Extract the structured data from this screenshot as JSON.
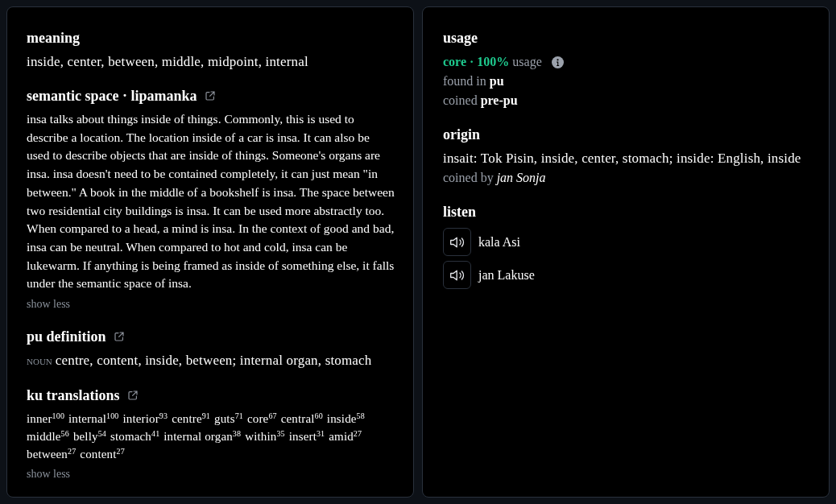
{
  "meaning": {
    "heading": "meaning",
    "text": "inside, center, between, middle, midpoint, internal"
  },
  "semantic_space": {
    "heading": "semantic space · lipamanka",
    "text": "insa talks about things inside of things. Commonly, this is used to describe a location. The location inside of a car is insa. It can also be used to describe objects that are inside of things. Someone's organs are insa. insa doesn't need to be contained completely, it can just mean \"in between.\" A book in the middle of a bookshelf is insa. The space between two residential city buildings is insa. It can be used more abstractly too. When compared to a head, a mind is insa. In the context of good and bad, insa can be neutral. When compared to hot and cold, insa can be lukewarm. If anything is being framed as inside of something else, it falls under the semantic space of insa.",
    "toggle": "show less"
  },
  "pu_definition": {
    "heading": "pu definition",
    "part_of_speech": "NOUN",
    "text": "centre, content, inside, between; internal organ, stomach"
  },
  "ku_translations": {
    "heading": "ku translations",
    "items": [
      {
        "word": "inner",
        "score": "100"
      },
      {
        "word": "internal",
        "score": "100"
      },
      {
        "word": "interior",
        "score": "93"
      },
      {
        "word": "centre",
        "score": "91"
      },
      {
        "word": "guts",
        "score": "71"
      },
      {
        "word": "core",
        "score": "67"
      },
      {
        "word": "central",
        "score": "60"
      },
      {
        "word": "inside",
        "score": "58"
      },
      {
        "word": "middle",
        "score": "56"
      },
      {
        "word": "belly",
        "score": "54"
      },
      {
        "word": "stomach",
        "score": "41"
      },
      {
        "word": "internal organ",
        "score": "38"
      },
      {
        "word": "within",
        "score": "35"
      },
      {
        "word": "insert",
        "score": "31"
      },
      {
        "word": "amid",
        "score": "27"
      },
      {
        "word": "between",
        "score": "27"
      },
      {
        "word": "content",
        "score": "27"
      }
    ],
    "toggle": "show less"
  },
  "usage": {
    "heading": "usage",
    "lines": [
      {
        "kind": "category",
        "text": "**core · 100%** usage"
      },
      {
        "kind": "fact",
        "text": "found in **pu**"
      },
      {
        "kind": "fact",
        "text": "coined **pre-pu**"
      }
    ]
  },
  "origin": {
    "heading": "origin",
    "text": "insait: Tok Pisin, inside, center, stomach; inside: English, inside",
    "credit": "coined by *jan Sonja*"
  },
  "listen": {
    "heading": "listen",
    "recordings": [
      {
        "speaker": "kala Asi"
      },
      {
        "speaker": "jan Lakuse"
      }
    ]
  }
}
